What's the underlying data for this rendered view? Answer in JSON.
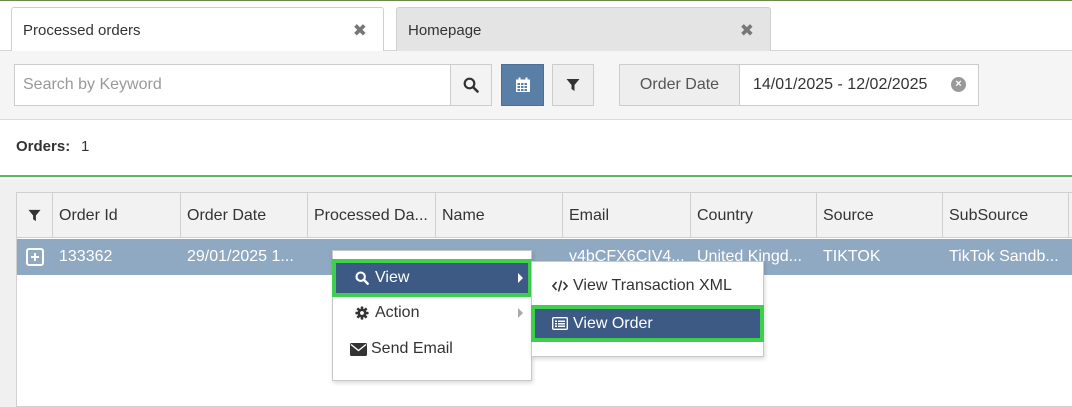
{
  "tabs": [
    {
      "label": "Processed orders",
      "close": "✖"
    },
    {
      "label": "Homepage",
      "close": "✖"
    }
  ],
  "toolbar": {
    "search_placeholder": "Search by Keyword",
    "search_value": "",
    "date_filter_label": "Order Date",
    "date_range": "14/01/2025 - 12/02/2025",
    "date_clear": "×"
  },
  "orders": {
    "label": "Orders:",
    "count": "1"
  },
  "grid": {
    "columns": [
      "Order Id",
      "Order Date",
      "Processed Da...",
      "Name",
      "Email",
      "Country",
      "Source",
      "SubSource"
    ],
    "row": {
      "order_id": "133362",
      "order_date": "29/01/2025 1...",
      "processed_date": "",
      "name": "",
      "email": "v4bCFX6CIV4...",
      "country": "United Kingd...",
      "source": "TIKTOK",
      "subsource": "TikTok Sandb..."
    }
  },
  "context_menu": {
    "items": [
      {
        "label": "View",
        "icon": "search-icon"
      },
      {
        "label": "Action",
        "icon": "gear-icon"
      },
      {
        "label": "Send Email",
        "icon": "envelope-icon"
      }
    ],
    "submenu": [
      {
        "label": "View Transaction XML",
        "icon": "code-icon"
      },
      {
        "label": "View Order",
        "icon": "list-alt-icon"
      }
    ]
  },
  "colors": {
    "selected_row": "#8fa9c2",
    "menu_highlight": "#3c5a84",
    "annotation_outline": "#3ecf4e",
    "accent_line": "#5cb85c",
    "calendar_button": "#5a7fa6"
  }
}
